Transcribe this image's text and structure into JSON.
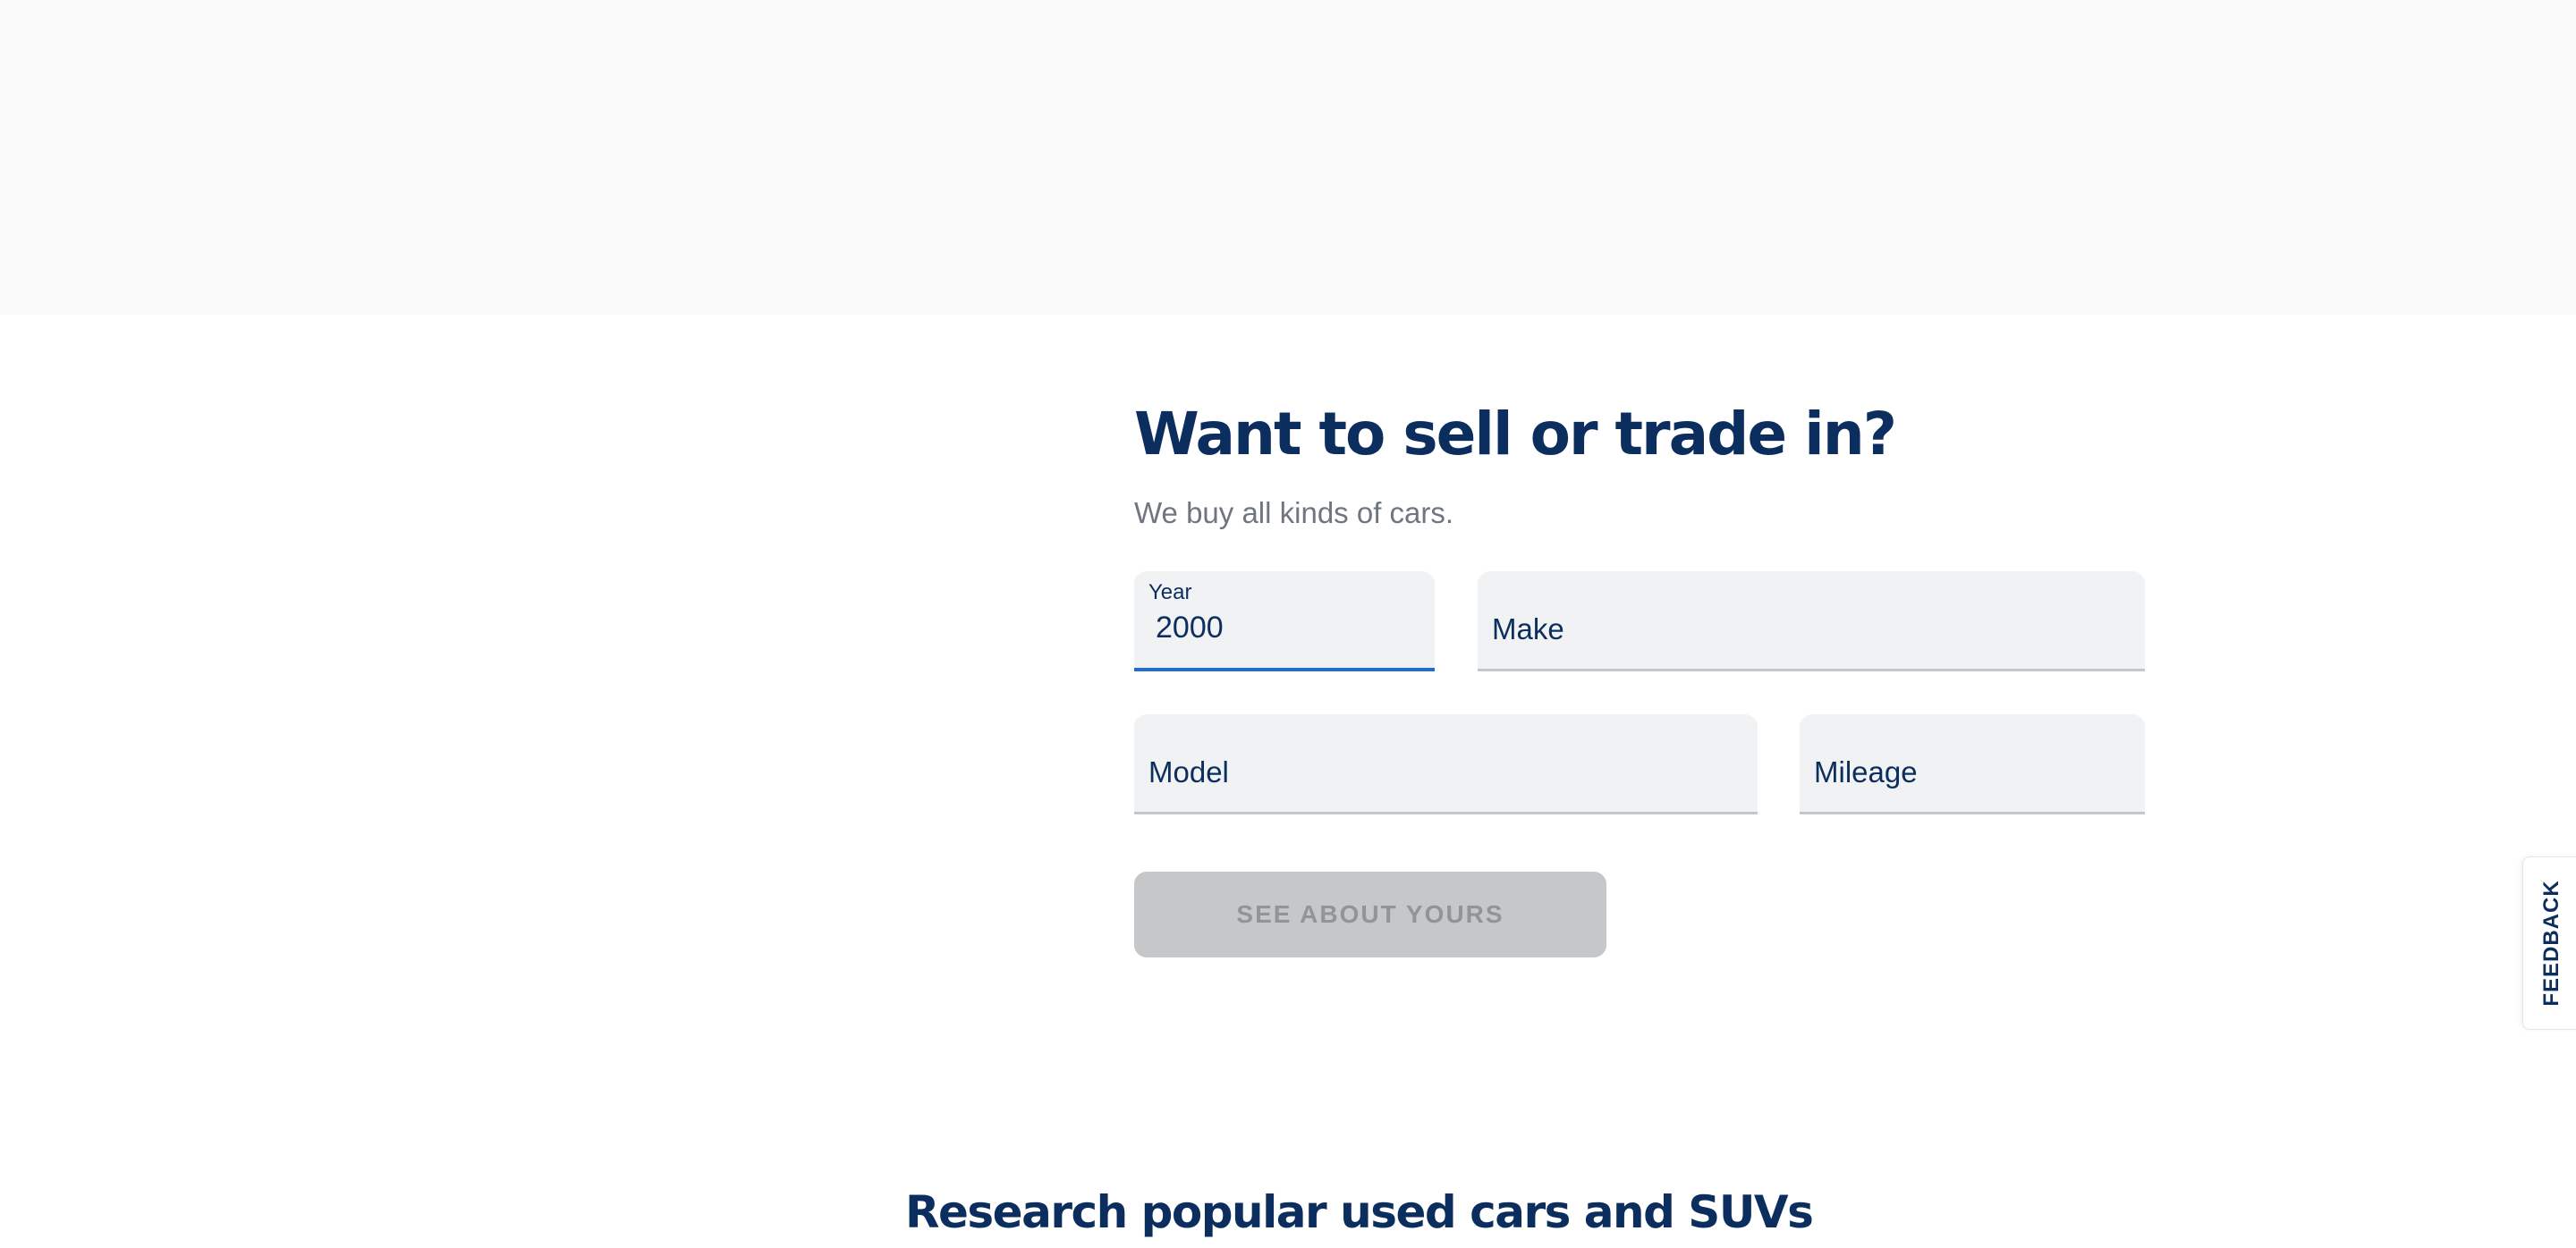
{
  "sell_trade": {
    "heading": "Want to sell or trade in?",
    "subheading": "We buy all kinds of cars.",
    "year": {
      "label": "Year",
      "value": "2000"
    },
    "make": {
      "placeholder": "Make"
    },
    "model": {
      "placeholder": "Model"
    },
    "mileage": {
      "placeholder": "Mileage"
    },
    "submit_label": "SEE ABOUT YOURS"
  },
  "research": {
    "heading": "Research popular used cars and SUVs"
  },
  "feedback_tab": {
    "label": "FEEDBACK"
  },
  "colors": {
    "brand_navy": "#0c2e5e",
    "focus_blue": "#1f6ed4",
    "field_bg": "#f0f2f4",
    "button_disabled_bg": "#c6c7c9",
    "top_band_bg": "#f9f9f9"
  }
}
